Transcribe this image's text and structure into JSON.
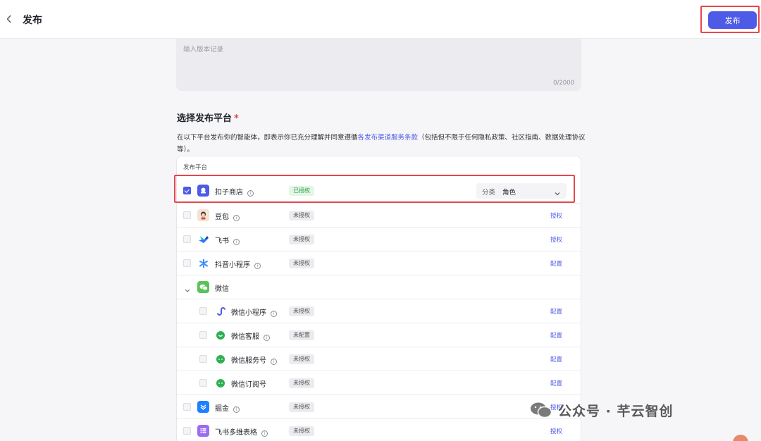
{
  "header": {
    "title": "发布",
    "publish_label": "发布"
  },
  "version": {
    "placeholder": "输入版本记录",
    "counter": "0/2000"
  },
  "section": {
    "title": "选择发布平台",
    "required_mark": "*",
    "desc_before": "在以下平台发布你的智能体，即表示你已充分理解并同意遵循",
    "desc_link": "各发布渠道服务条款",
    "desc_after": "（包括但不限于任何隐私政策、社区指南、数据处理协议等）。"
  },
  "card": {
    "header": "发布平台",
    "platforms": [
      {
        "name": "扣子商店",
        "info": true,
        "status": "已授权",
        "status_kind": "ok",
        "checked": true,
        "icon": "coze-store-icon",
        "color": "#4e5be6"
      },
      {
        "name": "豆包",
        "info": true,
        "status": "未授权",
        "action": "授权",
        "checked": false,
        "icon": "doubao-icon",
        "color": "#f2e3d4"
      },
      {
        "name": "飞书",
        "info": true,
        "status": "未授权",
        "action": "授权",
        "checked": false,
        "icon": "feishu-icon",
        "color": "#3370ff"
      },
      {
        "name": "抖音小程序",
        "info": true,
        "status": "未授权",
        "action": "配置",
        "checked": false,
        "icon": "douyin-miniapp-icon",
        "color": "#3c8cff"
      }
    ],
    "category": {
      "label": "分类",
      "value": "角色"
    },
    "wechat_group": {
      "name": "微信",
      "icon": "wechat-icon",
      "color": "#5ac25a"
    },
    "wechat_items": [
      {
        "name": "微信小程序",
        "info": true,
        "status": "未授权",
        "action": "配置",
        "icon": "wechat-miniapp-icon"
      },
      {
        "name": "微信客服",
        "info": true,
        "status": "未配置",
        "action": "配置",
        "icon": "wechat-service-icon"
      },
      {
        "name": "微信服务号",
        "info": true,
        "status": "未授权",
        "action": "配置",
        "icon": "wechat-official-icon"
      },
      {
        "name": "微信订阅号",
        "info": false,
        "status": "未授权",
        "action": "配置",
        "icon": "wechat-subscription-icon"
      }
    ],
    "more": [
      {
        "name": "掘金",
        "info": true,
        "status": "未授权",
        "action": "授权",
        "icon": "juejin-icon",
        "color": "#1e80ff"
      },
      {
        "name": "飞书多维表格",
        "info": true,
        "status": "未授权",
        "action": "授权",
        "icon": "feishu-bitable-icon",
        "color": "#9b6cf2"
      }
    ]
  },
  "watermark": {
    "text": "公众号 · 芊云智创"
  }
}
